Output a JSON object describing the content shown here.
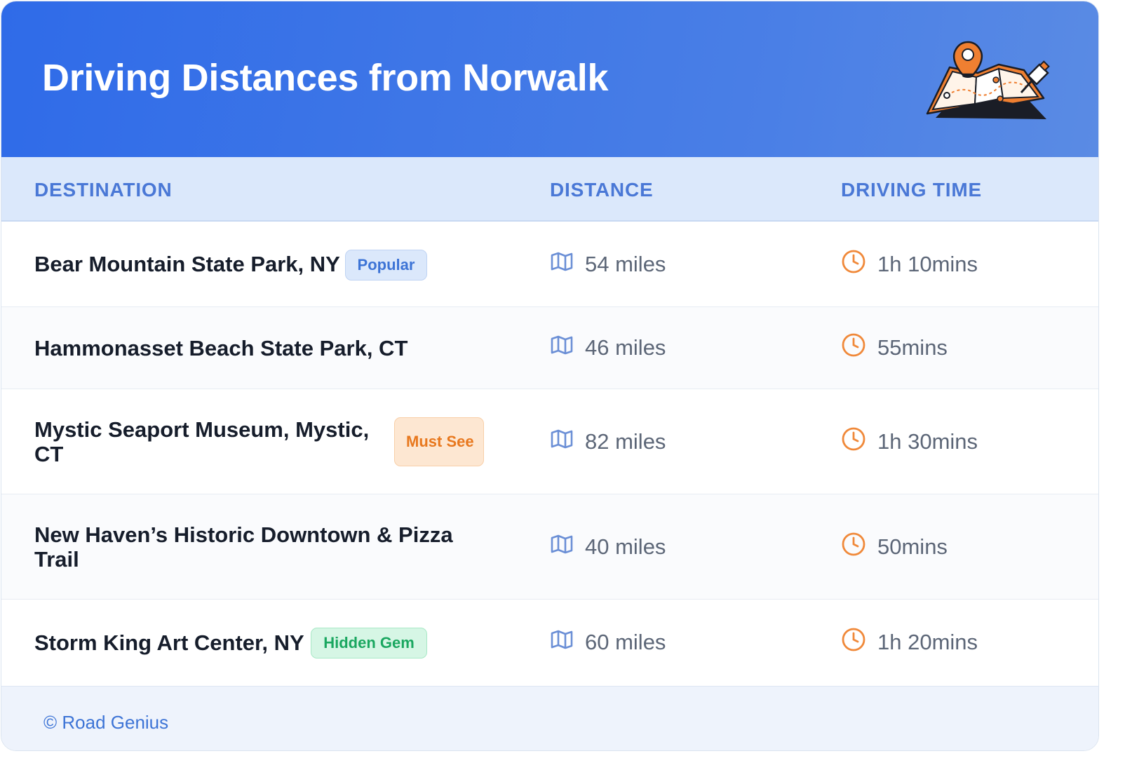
{
  "title": "Driving Distances from Norwalk",
  "columns": {
    "destination": "DESTINATION",
    "distance": "DISTANCE",
    "driving_time": "DRIVING TIME"
  },
  "rows": [
    {
      "destination": "Bear Mountain State Park, NY",
      "badge": "Popular",
      "badge_color": "#3d74d6",
      "distance": "54 miles",
      "time": "1h 10mins"
    },
    {
      "destination": "Hammonasset Beach State Park, CT",
      "badge": "",
      "distance": "46 miles",
      "time": "55mins"
    },
    {
      "destination": "Mystic Seaport Museum, Mystic, CT",
      "badge": "Must See",
      "badge_color": "#e8781e",
      "distance": "82 miles",
      "time": "1h 30mins"
    },
    {
      "destination": "New Haven’s Historic Downtown & Pizza Trail",
      "badge": "",
      "distance": "40 miles",
      "time": "50mins"
    },
    {
      "destination": "Storm King Art Center, NY",
      "badge": "Hidden Gem",
      "badge_color": "#1aa760",
      "distance": "60 miles",
      "time": "1h 20mins"
    }
  ],
  "icons": {
    "distance": "map-icon",
    "time": "clock-icon",
    "header": "map-pin-illustration"
  },
  "colors": {
    "header": "#2f6be8",
    "accent_blue": "#3d74d6",
    "accent_orange": "#f0893a"
  },
  "footer": {
    "copyright": "© Road Genius"
  }
}
